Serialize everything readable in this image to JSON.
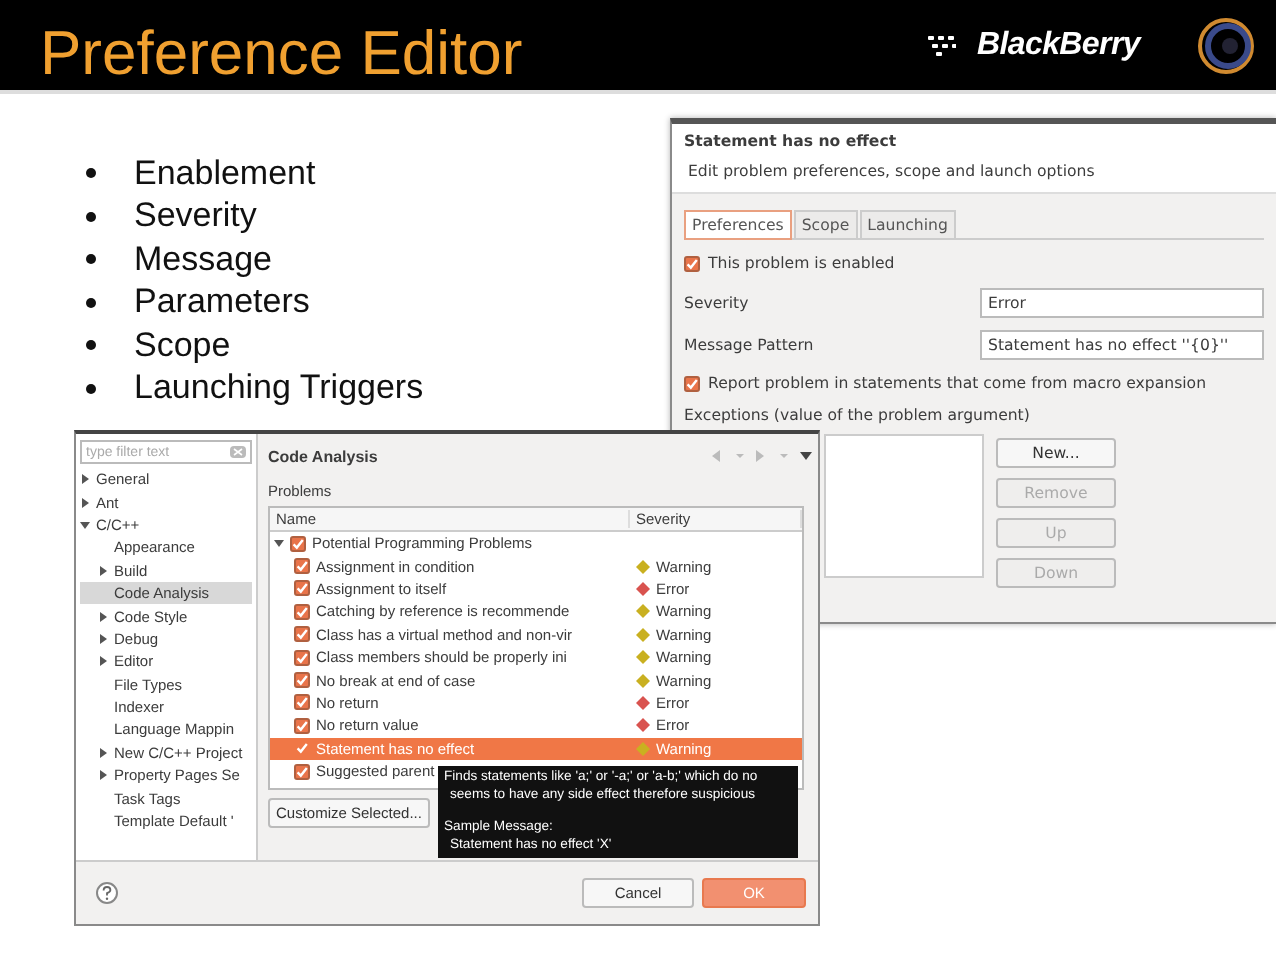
{
  "slide": {
    "title": "Preference Editor",
    "logo_text": "BlackBerry",
    "bullets": [
      "Enablement",
      "Severity",
      "Message",
      "Parameters",
      "Scope",
      "Launching Triggers"
    ]
  },
  "problem_dialog": {
    "title": "Statement has no effect",
    "description": "Edit problem preferences, scope and launch options",
    "tabs": [
      {
        "label": "Preferences",
        "selected": true
      },
      {
        "label": "Scope",
        "selected": false
      },
      {
        "label": "Launching",
        "selected": false
      }
    ],
    "enabled_checkbox": {
      "label": "This problem is enabled",
      "checked": true
    },
    "severity": {
      "label": "Severity",
      "value": "Error"
    },
    "message_pattern": {
      "label": "Message Pattern",
      "value": "Statement has no effect ''{0}''"
    },
    "macro_checkbox": {
      "label": "Report problem in statements that come from macro expansion",
      "checked": true
    },
    "exceptions_label": "Exceptions (value of the problem argument)",
    "buttons": [
      {
        "label": "New...",
        "disabled": false
      },
      {
        "label": "Remove",
        "disabled": true
      },
      {
        "label": "Up",
        "disabled": true
      },
      {
        "label": "Down",
        "disabled": true
      }
    ]
  },
  "preferences_window": {
    "filter": {
      "placeholder": "type filter text"
    },
    "tree": [
      {
        "label": "General",
        "expanded": false,
        "selected": false
      },
      {
        "label": "Ant",
        "expanded": false,
        "selected": false
      },
      {
        "label": "C/C++",
        "expanded": true,
        "selected": false,
        "children": [
          {
            "label": "Appearance",
            "selected": false
          },
          {
            "label": "Build",
            "expanded": false,
            "selected": false
          },
          {
            "label": "Code Analysis",
            "selected": true
          },
          {
            "label": "Code Style",
            "expanded": false,
            "selected": false
          },
          {
            "label": "Debug",
            "expanded": false,
            "selected": false
          },
          {
            "label": "Editor",
            "expanded": false,
            "selected": false
          },
          {
            "label": "File Types",
            "selected": false
          },
          {
            "label": "Indexer",
            "selected": false
          },
          {
            "label": "Language Mappin",
            "selected": false
          },
          {
            "label": "New C/C++ Project",
            "expanded": false,
            "selected": false
          },
          {
            "label": "Property Pages Se",
            "expanded": false,
            "selected": false
          },
          {
            "label": "Task Tags",
            "selected": false
          },
          {
            "label": "Template Default '",
            "selected": false
          }
        ]
      }
    ],
    "page_title": "Code Analysis",
    "problems_label": "Problems",
    "columns": [
      "Name",
      "Severity"
    ],
    "problems": [
      {
        "label": "Potential Programming Problems",
        "checked": true,
        "expanded": true,
        "children": [
          {
            "name": "Assignment in condition",
            "checked": true,
            "selected": false,
            "severity": "Warning",
            "kind": "warning"
          },
          {
            "name": "Assignment to itself",
            "checked": true,
            "selected": false,
            "severity": "Error",
            "kind": "error"
          },
          {
            "name": "Catching by reference is recommende",
            "checked": true,
            "selected": false,
            "severity": "Warning",
            "kind": "warning"
          },
          {
            "name": "Class has a virtual method and non-vir",
            "checked": true,
            "selected": false,
            "severity": "Warning",
            "kind": "warning"
          },
          {
            "name": "Class members should be properly ini",
            "checked": true,
            "selected": false,
            "severity": "Warning",
            "kind": "warning"
          },
          {
            "name": "No break at end of case",
            "checked": true,
            "selected": false,
            "severity": "Warning",
            "kind": "warning"
          },
          {
            "name": "No return",
            "checked": true,
            "selected": false,
            "severity": "Error",
            "kind": "error"
          },
          {
            "name": "No return value",
            "checked": true,
            "selected": false,
            "severity": "Error",
            "kind": "error"
          },
          {
            "name": "Statement has no effect",
            "checked": true,
            "selected": true,
            "severity": "Warning",
            "kind": "warning"
          },
          {
            "name": "Suggested parent",
            "checked": true,
            "selected": false
          }
        ]
      }
    ],
    "tooltip": [
      "Finds statements like 'a;' or '-a;' or 'a-b;' which do no",
      "seems to have any side effect therefore suspicious",
      "Sample Message:",
      "Statement has no effect 'X'"
    ],
    "customize_button": "Customize Selected...",
    "buttons": [
      {
        "label": "Cancel",
        "kind": "normal"
      },
      {
        "label": "OK",
        "kind": "default"
      }
    ]
  }
}
